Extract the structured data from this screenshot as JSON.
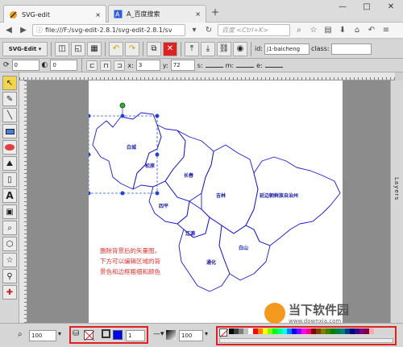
{
  "browser": {
    "tabs": [
      {
        "label": "SVG-edit",
        "close": "×"
      },
      {
        "label": "A_百度搜索",
        "close": "×"
      }
    ],
    "new_tab": "+",
    "window_controls": [
      "—",
      "□",
      "✕"
    ],
    "url": "file:///F:/svg-edit-2.8.1/svg-edit-2.8.1/sv",
    "search_placeholder": "百度 <Ctrl+K>"
  },
  "toolbar": {
    "app_menu": "SVG-Edit ▾",
    "id_label": "id:",
    "id_value": "j1-baicheng",
    "class_label": "class:",
    "class_value": ""
  },
  "toolbar2": {
    "rotate_value": "0",
    "blur_value": "0",
    "x_label": "x:",
    "x_value": "3",
    "y_label": "y:",
    "y_value": "72",
    "s_label": "s:",
    "m_label": "m:",
    "e_label": "e:"
  },
  "map": {
    "regions": [
      "白城",
      "松原",
      "长春",
      "吉林",
      "延边朝鲜族自治州",
      "四平",
      "辽源",
      "白山",
      "通化"
    ],
    "note_lines": [
      "删除背景后的矢量图，",
      "下方可以编辑区域的背",
      "景色和边框粗细和颜色"
    ]
  },
  "layers_label": "Layers",
  "bottom": {
    "zoom_value": "100",
    "stroke_width": "1",
    "opacity_value": "100",
    "fill_color": "#ffffff",
    "stroke_color": "#0000ff"
  },
  "palette": [
    "#000000",
    "#3f3f3f",
    "#7f7f7f",
    "#bfbfbf",
    "#ffffff",
    "#ff0000",
    "#ff7f00",
    "#ffff00",
    "#7fff00",
    "#00ff00",
    "#00ff7f",
    "#00ffff",
    "#007fff",
    "#0000ff",
    "#7f00ff",
    "#ff00ff",
    "#ff007f",
    "#7f0000",
    "#7f3f00",
    "#7f7f00",
    "#3f7f00",
    "#007f00",
    "#007f3f",
    "#007f7f",
    "#003f7f",
    "#00007f",
    "#3f007f",
    "#7f007f",
    "#7f003f",
    "#ffaaaa"
  ],
  "watermark": "当下软件园",
  "watermark_url": "www.downxia.com",
  "accent": "#e02020"
}
